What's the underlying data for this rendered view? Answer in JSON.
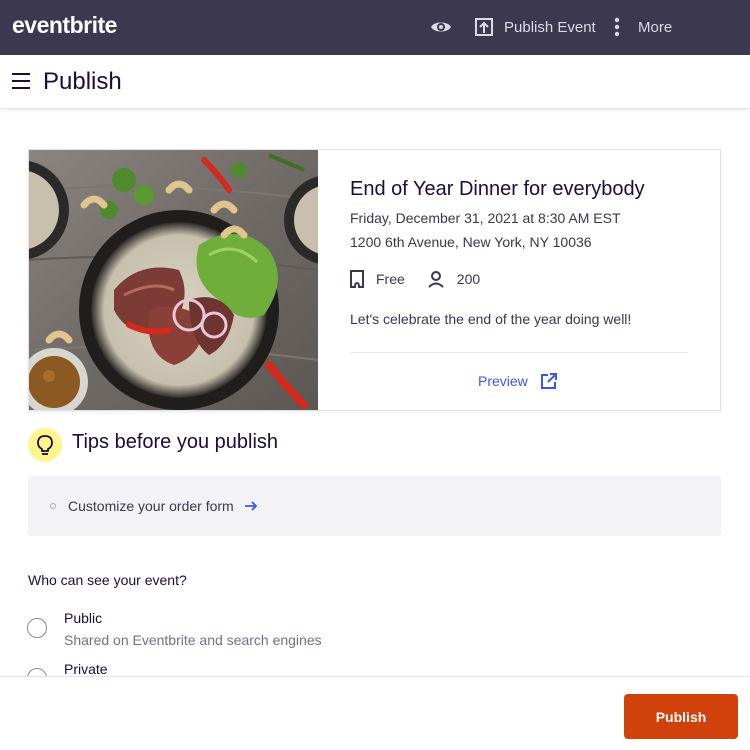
{
  "topbar": {
    "logo": "eventbrite",
    "preview_icon": "eye-icon",
    "publish_event_label": "Publish Event",
    "more_label": "More"
  },
  "header": {
    "title": "Publish"
  },
  "event": {
    "title": "End of Year Dinner for everybody",
    "date": "Friday, December 31, 2021 at 8:30 AM EST",
    "address": "1200 6th Avenue, New York, NY 10036",
    "price": "Free",
    "capacity": "200",
    "description": "Let's celebrate the end of the year doing well!",
    "preview_label": "Preview"
  },
  "tips": {
    "title": "Tips before you publish",
    "items": [
      {
        "label": "Customize your order form"
      }
    ]
  },
  "visibility": {
    "question": "Who can see your event?",
    "options": [
      {
        "label": "Public",
        "description": "Shared on Eventbrite and search engines"
      },
      {
        "label": "Private"
      }
    ]
  },
  "footer": {
    "publish_label": "Publish"
  },
  "colors": {
    "topbar": "#3b3850",
    "accent_link": "#3659e3",
    "publish_button": "#d1410c",
    "tips_icon_bg": "#fff58f"
  }
}
